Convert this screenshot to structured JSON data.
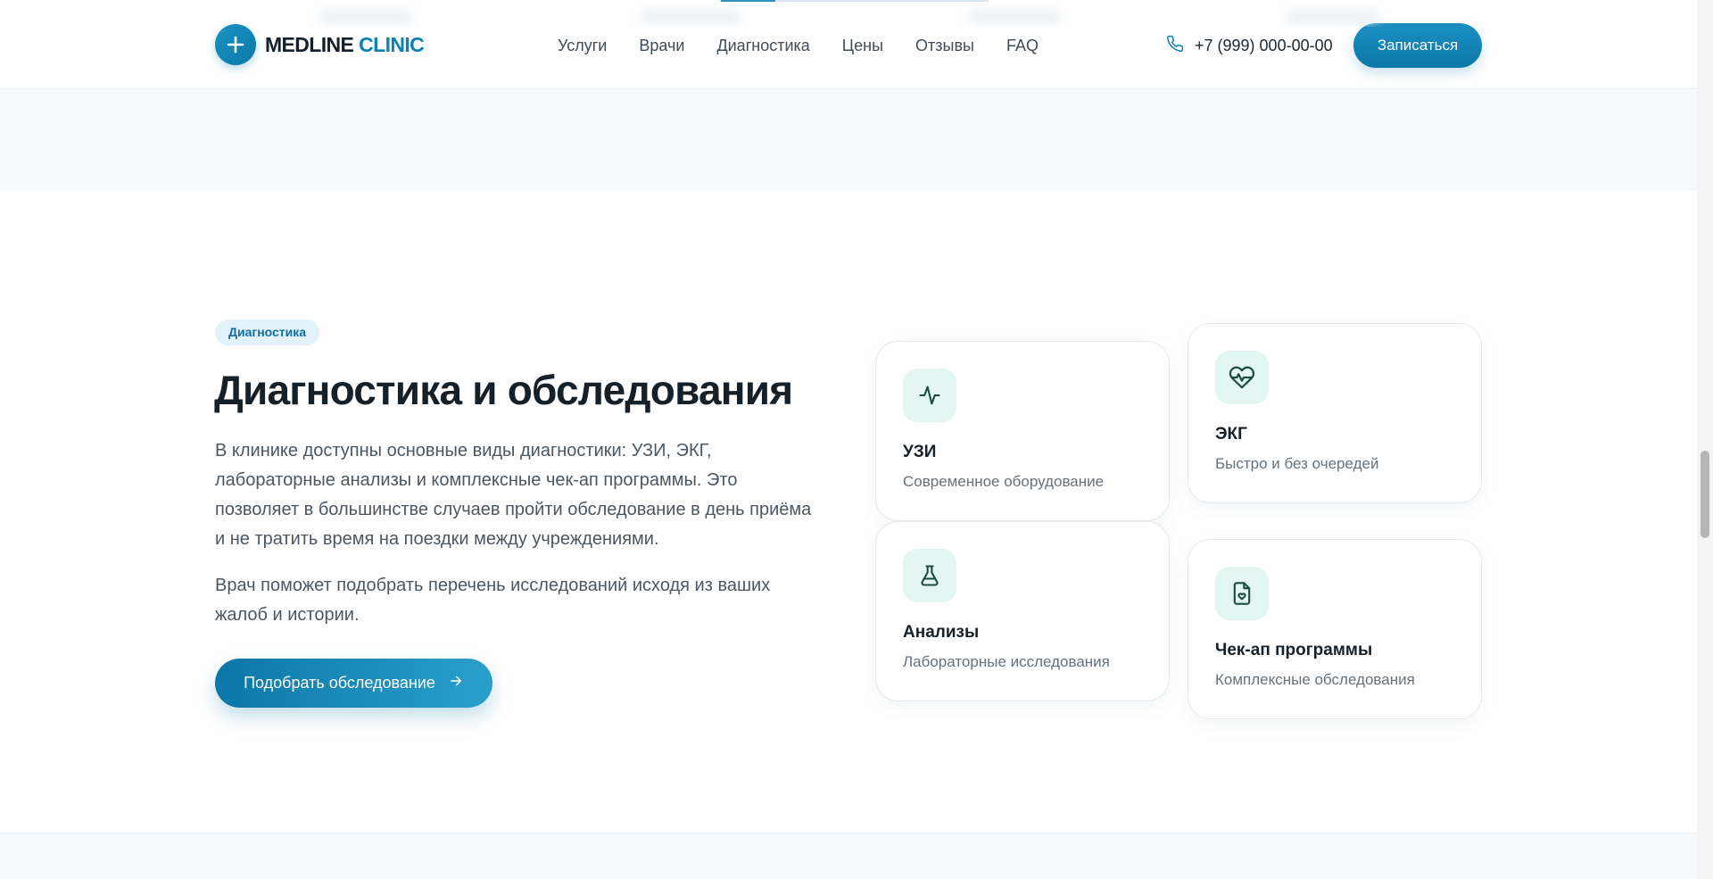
{
  "header": {
    "logo": {
      "word1": "MEDLINE",
      "word2": "CLINIC",
      "icon": "plus-icon",
      "brand_color": "#0d80b4"
    },
    "nav": [
      {
        "label": "Услуги"
      },
      {
        "label": "Врачи"
      },
      {
        "label": "Диагностика"
      },
      {
        "label": "Цены"
      },
      {
        "label": "Отзывы"
      },
      {
        "label": "FAQ"
      }
    ],
    "phone": {
      "icon": "phone-icon",
      "number": "+7 (999) 000-00-00"
    },
    "cta": "Записаться"
  },
  "section": {
    "tag": "Диагностика",
    "title": "Диагностика и обследования",
    "paragraph1": "В клинике доступны основные виды диагностики: УЗИ, ЭКГ, лабораторные анализы и комплексные чек-ап программы. Это позволяет в большинстве случаев пройти обследование в день приёма и не тратить время на поездки между учреждениями.",
    "paragraph2": "Врач поможет подобрать перечень исследований исходя из ваших жалоб и истории.",
    "cta": {
      "label": "Подобрать обследование",
      "icon": "arrow-right-icon"
    }
  },
  "cards": [
    {
      "icon": "activity-pulse-icon",
      "title": "УЗИ",
      "subtitle": "Современное оборудование"
    },
    {
      "icon": "heart-pulse-icon",
      "title": "ЭКГ",
      "subtitle": "Быстро и без очередей"
    },
    {
      "icon": "flask-icon",
      "title": "Анализы",
      "subtitle": "Лабораторные исследования"
    },
    {
      "icon": "document-heart-icon",
      "title": "Чек-ап программы",
      "subtitle": "Комплексные обследования"
    }
  ],
  "colors": {
    "accent": "#0b78a8",
    "icon_tile_bg": "#e3f6f2",
    "icon_stroke": "#1f4a44",
    "tag_bg": "#e3f2fa",
    "band_bg": "#f6fafd"
  }
}
